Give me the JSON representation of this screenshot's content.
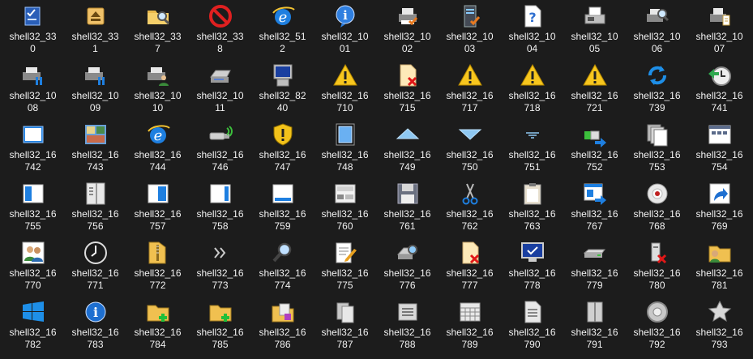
{
  "icons": [
    {
      "l1": "shell32_33",
      "l2": "0",
      "icon": "checklist-icon"
    },
    {
      "l1": "shell32_33",
      "l2": "1",
      "icon": "eject-icon"
    },
    {
      "l1": "shell32_33",
      "l2": "7",
      "icon": "folder-search-icon"
    },
    {
      "l1": "shell32_33",
      "l2": "8",
      "icon": "no-entry-icon"
    },
    {
      "l1": "shell32_51",
      "l2": "2",
      "icon": "internet-explorer-icon"
    },
    {
      "l1": "shell32_10",
      "l2": "01",
      "icon": "info-bubble-icon"
    },
    {
      "l1": "shell32_10",
      "l2": "02",
      "icon": "printer-check-icon"
    },
    {
      "l1": "shell32_10",
      "l2": "03",
      "icon": "server-check-icon"
    },
    {
      "l1": "shell32_10",
      "l2": "04",
      "icon": "help-document-icon"
    },
    {
      "l1": "shell32_10",
      "l2": "05",
      "icon": "fax-icon"
    },
    {
      "l1": "shell32_10",
      "l2": "06",
      "icon": "printer-search-icon"
    },
    {
      "l1": "shell32_10",
      "l2": "07",
      "icon": "printer-document-icon"
    },
    {
      "l1": "shell32_10",
      "l2": "08",
      "icon": "printer-pause-icon"
    },
    {
      "l1": "shell32_10",
      "l2": "09",
      "icon": "printer-pause-icon"
    },
    {
      "l1": "shell32_10",
      "l2": "10",
      "icon": "printer-user-icon"
    },
    {
      "l1": "shell32_10",
      "l2": "11",
      "icon": "scanner-icon"
    },
    {
      "l1": "shell32_82",
      "l2": "40",
      "icon": "computer-icon"
    },
    {
      "l1": "shell32_16",
      "l2": "710",
      "icon": "warning-icon"
    },
    {
      "l1": "shell32_16",
      "l2": "715",
      "icon": "document-error-icon"
    },
    {
      "l1": "shell32_16",
      "l2": "717",
      "icon": "warning-icon"
    },
    {
      "l1": "shell32_16",
      "l2": "718",
      "icon": "warning-icon"
    },
    {
      "l1": "shell32_16",
      "l2": "721",
      "icon": "warning-icon"
    },
    {
      "l1": "shell32_16",
      "l2": "739",
      "icon": "refresh-icon"
    },
    {
      "l1": "shell32_16",
      "l2": "741",
      "icon": "clock-back-icon"
    },
    {
      "l1": "shell32_16",
      "l2": "742",
      "icon": "window-icon"
    },
    {
      "l1": "shell32_16",
      "l2": "743",
      "icon": "photo-collage-icon"
    },
    {
      "l1": "shell32_16",
      "l2": "744",
      "icon": "internet-explorer-icon"
    },
    {
      "l1": "shell32_16",
      "l2": "746",
      "icon": "usb-drive-icon"
    },
    {
      "l1": "shell32_16",
      "l2": "747",
      "icon": "shield-warning-icon"
    },
    {
      "l1": "shell32_16",
      "l2": "748",
      "icon": "square-frame-icon"
    },
    {
      "l1": "shell32_16",
      "l2": "749",
      "icon": "triangle-up-icon"
    },
    {
      "l1": "shell32_16",
      "l2": "750",
      "icon": "triangle-down-icon"
    },
    {
      "l1": "shell32_16",
      "l2": "751",
      "icon": "filter-lines-icon"
    },
    {
      "l1": "shell32_16",
      "l2": "752",
      "icon": "move-arrow-icon"
    },
    {
      "l1": "shell32_16",
      "l2": "753",
      "icon": "stacked-pages-icon"
    },
    {
      "l1": "shell32_16",
      "l2": "754",
      "icon": "window-grid-icon"
    },
    {
      "l1": "shell32_16",
      "l2": "755",
      "icon": "pane-left-icon"
    },
    {
      "l1": "shell32_16",
      "l2": "756",
      "icon": "book-pane-icon"
    },
    {
      "l1": "shell32_16",
      "l2": "757",
      "icon": "pane-middle-icon"
    },
    {
      "l1": "shell32_16",
      "l2": "758",
      "icon": "pane-right-icon"
    },
    {
      "l1": "shell32_16",
      "l2": "759",
      "icon": "pane-top-icon"
    },
    {
      "l1": "shell32_16",
      "l2": "760",
      "icon": "details-pane-icon"
    },
    {
      "l1": "shell32_16",
      "l2": "761",
      "icon": "floppy-disk-icon"
    },
    {
      "l1": "shell32_16",
      "l2": "762",
      "icon": "scissors-icon"
    },
    {
      "l1": "shell32_16",
      "l2": "763",
      "icon": "clipboard-icon"
    },
    {
      "l1": "shell32_16",
      "l2": "767",
      "icon": "window-arrow-icon"
    },
    {
      "l1": "shell32_16",
      "l2": "768",
      "icon": "disc-icon"
    },
    {
      "l1": "shell32_16",
      "l2": "769",
      "icon": "shortcut-arrow-icon"
    },
    {
      "l1": "shell32_16",
      "l2": "770",
      "icon": "users-icon"
    },
    {
      "l1": "shell32_16",
      "l2": "771",
      "icon": "clock-icon"
    },
    {
      "l1": "shell32_16",
      "l2": "772",
      "icon": "folder-zip-icon"
    },
    {
      "l1": "shell32_16",
      "l2": "773",
      "icon": "double-chevron-icon"
    },
    {
      "l1": "shell32_16",
      "l2": "774",
      "icon": "magnifier-icon"
    },
    {
      "l1": "shell32_16",
      "l2": "775",
      "icon": "notepad-pen-icon"
    },
    {
      "l1": "shell32_16",
      "l2": "776",
      "icon": "projector-icon"
    },
    {
      "l1": "shell32_16",
      "l2": "777",
      "icon": "document-error-icon"
    },
    {
      "l1": "shell32_16",
      "l2": "778",
      "icon": "monitor-check-icon"
    },
    {
      "l1": "shell32_16",
      "l2": "779",
      "icon": "drive-green-icon"
    },
    {
      "l1": "shell32_16",
      "l2": "780",
      "icon": "drive-error-icon"
    },
    {
      "l1": "shell32_16",
      "l2": "781",
      "icon": "folder-share-icon"
    },
    {
      "l1": "shell32_16",
      "l2": "782",
      "icon": "windows-logo-icon"
    },
    {
      "l1": "shell32_16",
      "l2": "783",
      "icon": "info-circle-icon"
    },
    {
      "l1": "shell32_16",
      "l2": "784",
      "icon": "folder-add-icon"
    },
    {
      "l1": "shell32_16",
      "l2": "785",
      "icon": "folder-add-icon"
    },
    {
      "l1": "shell32_16",
      "l2": "786",
      "icon": "folder-stack-icon"
    },
    {
      "l1": "shell32_16",
      "l2": "787",
      "icon": "pages-gray-icon"
    },
    {
      "l1": "shell32_16",
      "l2": "788",
      "icon": "list-box-icon"
    },
    {
      "l1": "shell32_16",
      "l2": "789",
      "icon": "calendar-grid-icon"
    },
    {
      "l1": "shell32_16",
      "l2": "790",
      "icon": "document-lines-icon"
    },
    {
      "l1": "shell32_16",
      "l2": "791",
      "icon": "book-gray-icon"
    },
    {
      "l1": "shell32_16",
      "l2": "792",
      "icon": "gear-disc-icon"
    },
    {
      "l1": "shell32_16",
      "l2": "793",
      "icon": "star-gear-icon"
    }
  ]
}
